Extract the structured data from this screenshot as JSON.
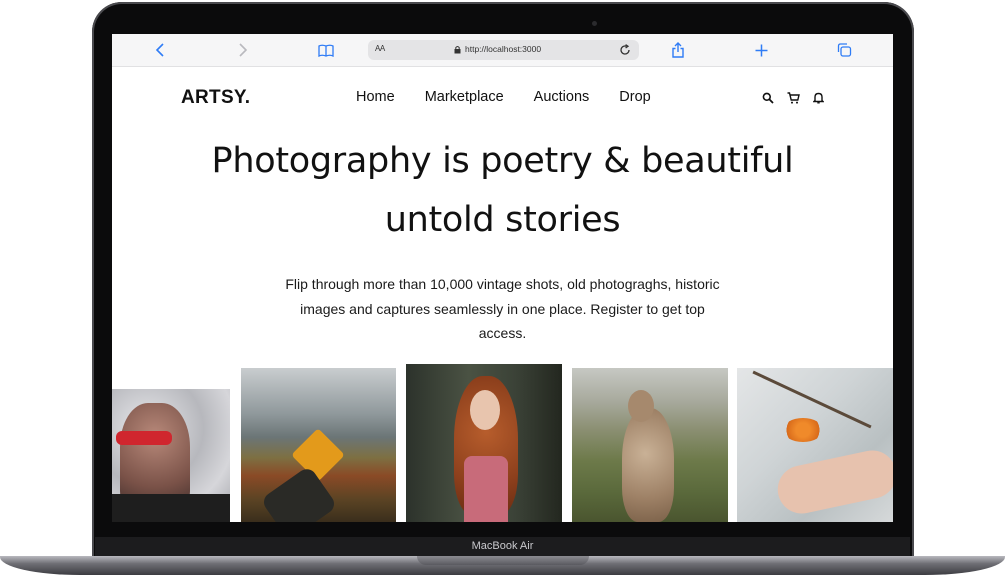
{
  "device": {
    "label": "MacBook Air"
  },
  "browser": {
    "text_size_label": "AA",
    "url": "http://localhost:3000",
    "icons": [
      "chevron-left-icon",
      "chevron-right-icon",
      "book-icon",
      "lock-icon",
      "reload-icon",
      "share-icon",
      "plus-icon",
      "tabs-icon"
    ]
  },
  "site": {
    "logo": "ARTSY.",
    "nav": [
      {
        "label": "Home"
      },
      {
        "label": "Marketplace"
      },
      {
        "label": "Auctions"
      },
      {
        "label": "Drop"
      }
    ],
    "nav_icons": [
      "search-icon",
      "cart-icon",
      "bell-icon"
    ]
  },
  "hero": {
    "headline_line1": "Photography is poetry & beautiful",
    "headline_line2": "untold stories",
    "description": "Flip through more than 10,000 vintage shots, old photograghs, historic images and captures seamlessly in one place. Register to get top access."
  },
  "gallery": [
    {
      "subject": "person-red-glasses-photo"
    },
    {
      "subject": "hand-maple-leaf-photo"
    },
    {
      "subject": "redhead-woman-photo"
    },
    {
      "subject": "kangaroo-photo"
    },
    {
      "subject": "hand-sea-buckthorn-photo"
    }
  ],
  "colors": {
    "accent_link": "#2f7cf6",
    "text": "#111111"
  }
}
